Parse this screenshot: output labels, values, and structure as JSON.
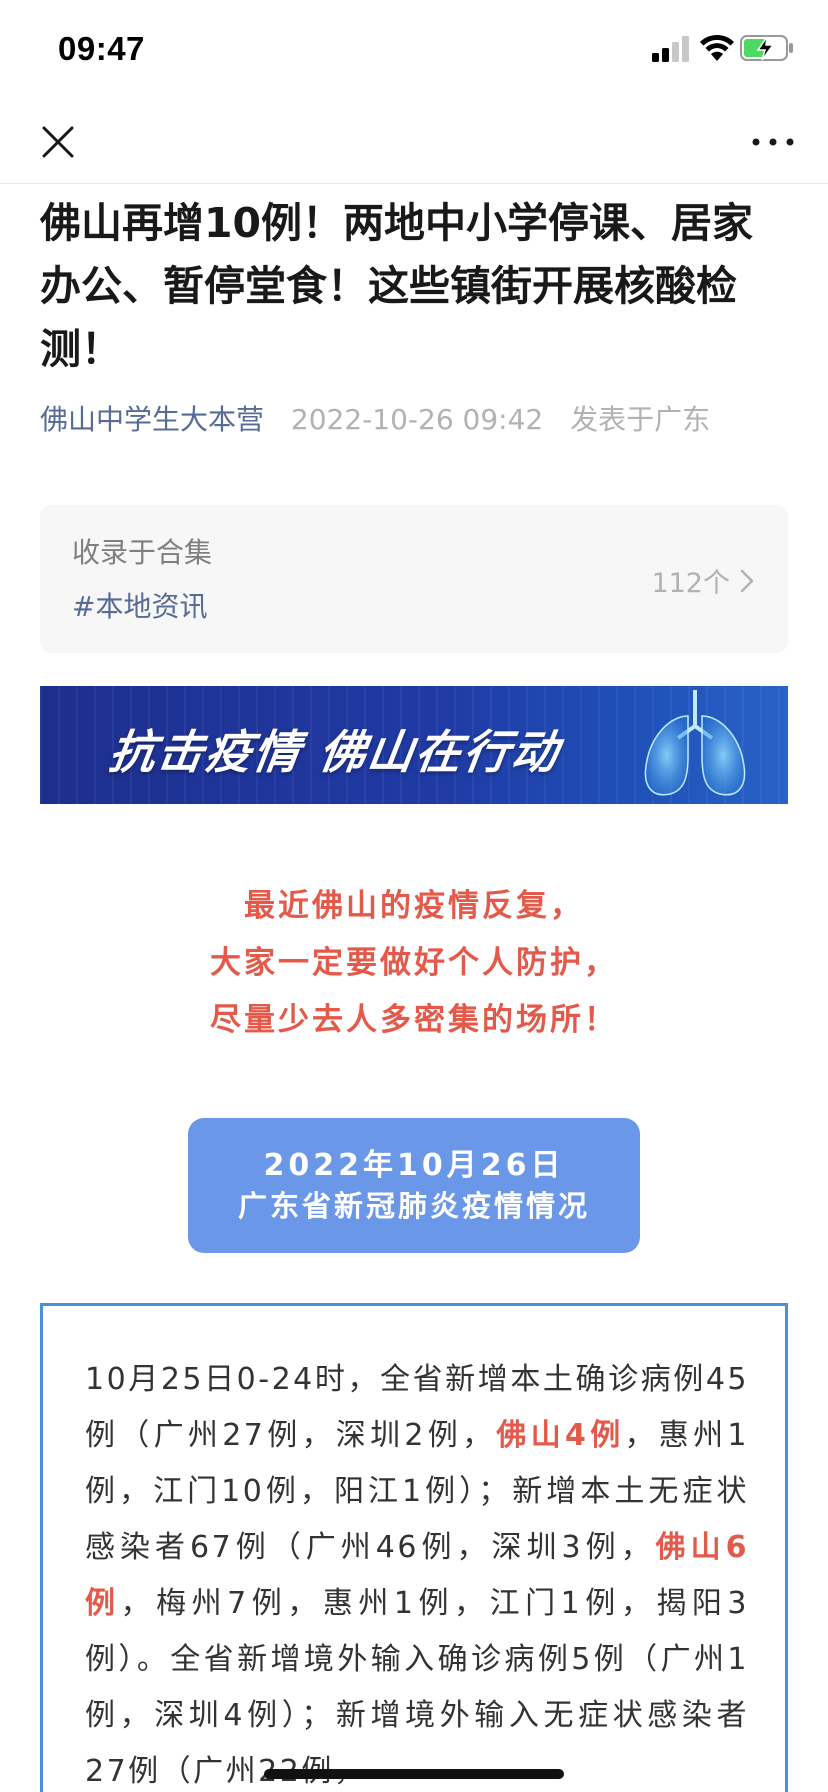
{
  "status_bar": {
    "time": "09:47"
  },
  "article": {
    "title": "佛山再增10例！两地中小学停课、居家办公、暂停堂食！这些镇街开展核酸检测！",
    "author": "佛山中学生大本营",
    "date": "2022-10-26 09:42",
    "location": "发表于广东"
  },
  "collection": {
    "label": "收录于合集",
    "tag": "#本地资讯",
    "count": "112个"
  },
  "banner": {
    "text": "抗击疫情 佛山在行动"
  },
  "note": {
    "line1": "最近佛山的疫情反复，",
    "line2": "大家一定要做好个人防护，",
    "line3": "尽量少去人多密集的场所！"
  },
  "date_pill": {
    "line1": "2022年10月26日",
    "line2": "广东省新冠肺炎疫情情况"
  },
  "info": {
    "p1": "10月25日0-24时，全省新增本土确诊病例45例（广州27例，深圳2例，",
    "hl1": "佛山4例",
    "p2": "，惠州1例，江门10例，阳江1例）；新增本土无症状感染者67例（广州46例，深圳3例，",
    "hl2": "佛山6例",
    "p3": "，梅州7例，惠州1例，江门1例，揭阳3例）。全省新增境外输入确诊病例5例（广州1例，深圳4例）；新增境外输入无症状感染者27例（广州22例，"
  },
  "colors": {
    "link": "#576b95",
    "meta_grey": "#b2b2b2",
    "highlight_red": "#e45a4a",
    "pill_blue": "#6b97e8",
    "box_border": "#4a8fd8"
  },
  "icons": {
    "close": "close-icon",
    "more": "more-icon",
    "signal": "signal-icon",
    "wifi": "wifi-icon",
    "battery": "battery-charging-icon",
    "chevron": "chevron-right-icon"
  }
}
